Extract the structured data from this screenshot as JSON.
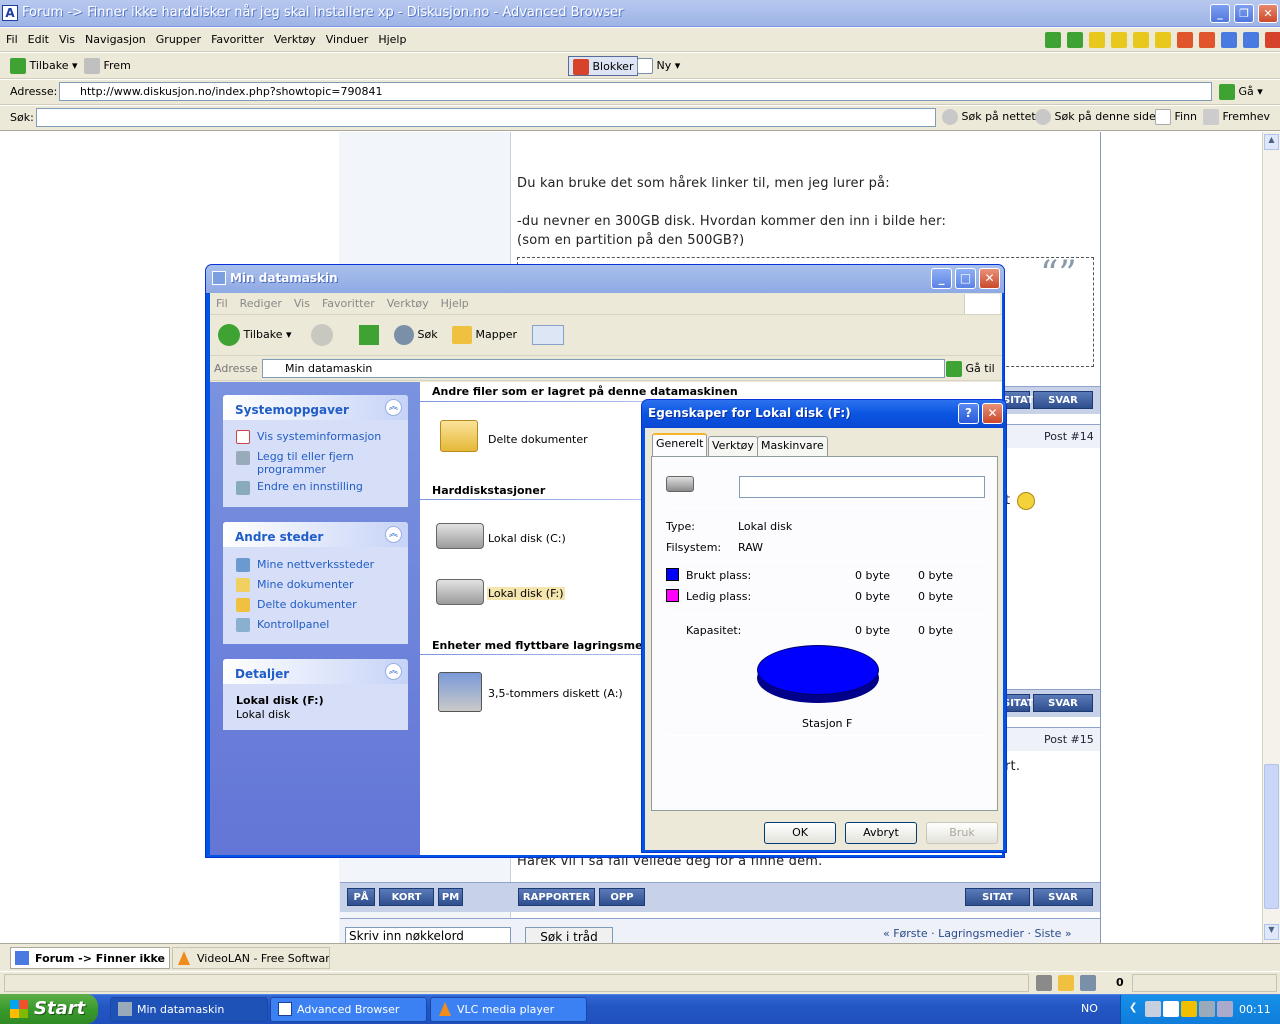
{
  "browser": {
    "title": "Forum -> Finner ikke harddisker når jeg skal installere xp - Diskusjon.no - Advanced Browser",
    "app_icon": "A",
    "menu": [
      "Fil",
      "Edit",
      "Vis",
      "Navigasjon",
      "Grupper",
      "Favoritter",
      "Verktøy",
      "Vinduer",
      "Hjelp"
    ],
    "toolbar": {
      "back": "Tilbake",
      "forward": "Frem",
      "block": "Blokker",
      "new": "Ny"
    },
    "address_label": "Adresse:",
    "address": "http://www.diskusjon.no/index.php?showtopic=790841",
    "go": "Gå",
    "search_label": "Søk:",
    "search_value": "",
    "search_web": "Søk på nettet",
    "search_page": "Søk på denne siden",
    "find": "Finn",
    "highlight": "Fremhev"
  },
  "forum": {
    "text_line1": "Du kan bruke det som hårek linker til, men jeg lurer på:",
    "text_line2": "-du nevner en 300GB disk. Hvordan kommer den inn i bilde her:",
    "text_line3": "(som en partition på den 500GB?)",
    "post14": "Post #14",
    "post15": "Post #15",
    "quote_label": "SITAT",
    "reply_label": "SVAR",
    "partial_t": "t",
    "partial_rt": "rt.",
    "bottom_text": "Hårek vil i så fall veilede deg for å finne dem.",
    "btn_pa": "PÅ",
    "btn_kort": "KORT",
    "btn_pm": "PM",
    "btn_rapporter": "RAPPORTER",
    "btn_opp": "OPP",
    "search_placeholder": "Skriv inn nøkkelord",
    "search_thread": "Søk i tråd",
    "pager": "« Første · Lagringsmedier · Siste »"
  },
  "tabs": [
    {
      "label": "Forum -> Finner ikke ..."
    },
    {
      "label": "VideoLAN - Free Softwar..."
    }
  ],
  "status": {
    "count": "0"
  },
  "taskbar": {
    "start": "Start",
    "tasks": [
      "Min datamaskin",
      "Advanced Browser",
      "VLC media player"
    ],
    "lang": "NO",
    "clock": "00:11"
  },
  "explorer": {
    "title": "Min datamaskin",
    "menu": [
      "Fil",
      "Rediger",
      "Vis",
      "Favoritter",
      "Verktøy",
      "Hjelp"
    ],
    "back": "Tilbake",
    "search": "Søk",
    "folders": "Mapper",
    "address_label": "Adresse",
    "address": "Min datamaskin",
    "go": "Gå til",
    "panels": {
      "system": {
        "title": "Systemoppgaver",
        "links": [
          "Vis systeminformasjon",
          "Legg til eller fjern programmer",
          "Endre en innstilling"
        ]
      },
      "other": {
        "title": "Andre steder",
        "links": [
          "Mine nettverkssteder",
          "Mine dokumenter",
          "Delte dokumenter",
          "Kontrollpanel"
        ]
      },
      "details": {
        "title": "Detaljer",
        "name": "Lokal disk (F:)",
        "type": "Lokal disk"
      }
    },
    "sections": {
      "files": "Andre filer som er lagret på denne datamaskinen",
      "hdd": "Harddiskstasjoner",
      "removable": "Enheter med flyttbare lagringsmedier"
    },
    "items": {
      "shared": "Delte dokumenter",
      "c": "Lokal disk (C:)",
      "f": "Lokal disk (F:)",
      "a": "3,5-tommers diskett (A:)"
    }
  },
  "dialog": {
    "title": "Egenskaper for Lokal disk (F:)",
    "tabs": [
      "Generelt",
      "Verktøy",
      "Maskinvare"
    ],
    "name_value": "",
    "type_label": "Type:",
    "type_value": "Lokal disk",
    "fs_label": "Filsystem:",
    "fs_value": "RAW",
    "used_label": "Brukt plass:",
    "used_bytes": "0 byte",
    "used_size": "0 byte",
    "free_label": "Ledig plass:",
    "free_bytes": "0 byte",
    "free_size": "0 byte",
    "cap_label": "Kapasitet:",
    "cap_bytes": "0 byte",
    "cap_size": "0 byte",
    "drive_label": "Stasjon F",
    "ok": "OK",
    "cancel": "Avbryt",
    "apply": "Bruk",
    "colors": {
      "used": "#0000ff",
      "free": "#ff00ff"
    }
  }
}
